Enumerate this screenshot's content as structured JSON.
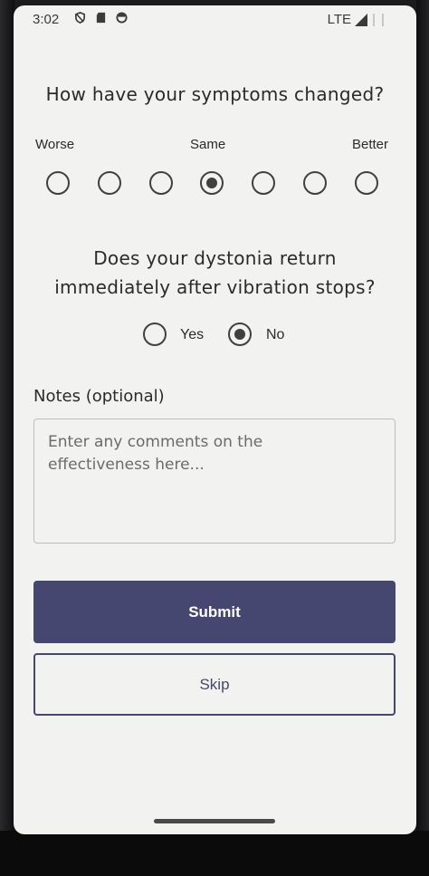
{
  "status_bar": {
    "time": "3:02",
    "network": "LTE",
    "icons": [
      "shield-icon",
      "sd-card-icon",
      "circle-app-icon",
      "signal-icon",
      "battery-icon"
    ]
  },
  "question1": {
    "title": "How have your symptoms changed?",
    "label_worse": "Worse",
    "label_same": "Same",
    "label_better": "Better",
    "scale_count": 7,
    "selected_index": 3
  },
  "question2": {
    "title_line1": "Does your dystonia return",
    "title_line2": "immediately after vibration stops?",
    "yes_label": "Yes",
    "no_label": "No",
    "selected": "No"
  },
  "notes": {
    "label": "Notes (optional)",
    "placeholder_line1": "Enter any comments on the",
    "placeholder_line2": "effectiveness here...",
    "value": ""
  },
  "actions": {
    "submit_label": "Submit",
    "skip_label": "Skip"
  },
  "colors": {
    "accent": "#454770",
    "background": "#f2f2f0",
    "text": "#2b2b2b"
  }
}
